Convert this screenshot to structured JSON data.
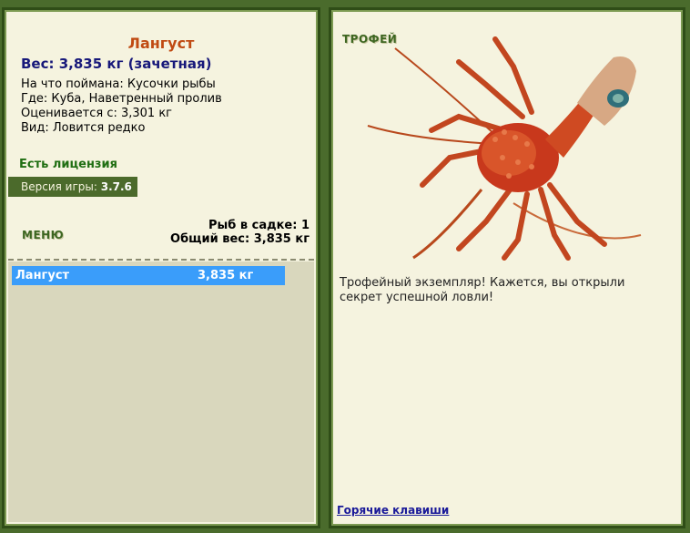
{
  "fish": {
    "name": "Лангуст",
    "weight": "Вес: 3,835 кг (зачетная)",
    "bait": "На что поймана: Кусочки рыбы",
    "location": "Где: Куба, Наветренный пролив",
    "valued": "Оценивается с: 3,301 кг",
    "rarity": "Вид: Ловится редко"
  },
  "license": "Есть лицензия",
  "version": {
    "label": "Версия игры:",
    "value": "3.7.6"
  },
  "menu_label": "МЕНЮ",
  "cage": {
    "count": "Рыб в садке: 1",
    "total": "Общий вес: 3,835 кг"
  },
  "catch_list": [
    {
      "name": "Лангуст",
      "weight": "3,835 кг"
    }
  ],
  "trophy": {
    "title": "ТРОФЕЙ",
    "text": "Трофейный экземпляр! Кажется, вы открыли секрет успешной ловли!"
  },
  "hotkeys_link": "Горячие клавиши",
  "colors": {
    "frame": "#4a6b2c",
    "panel": "#f5f3df",
    "title": "#c04a12",
    "weight": "#17187a",
    "license": "#1f6e12",
    "selection": "#3a9dfa"
  }
}
